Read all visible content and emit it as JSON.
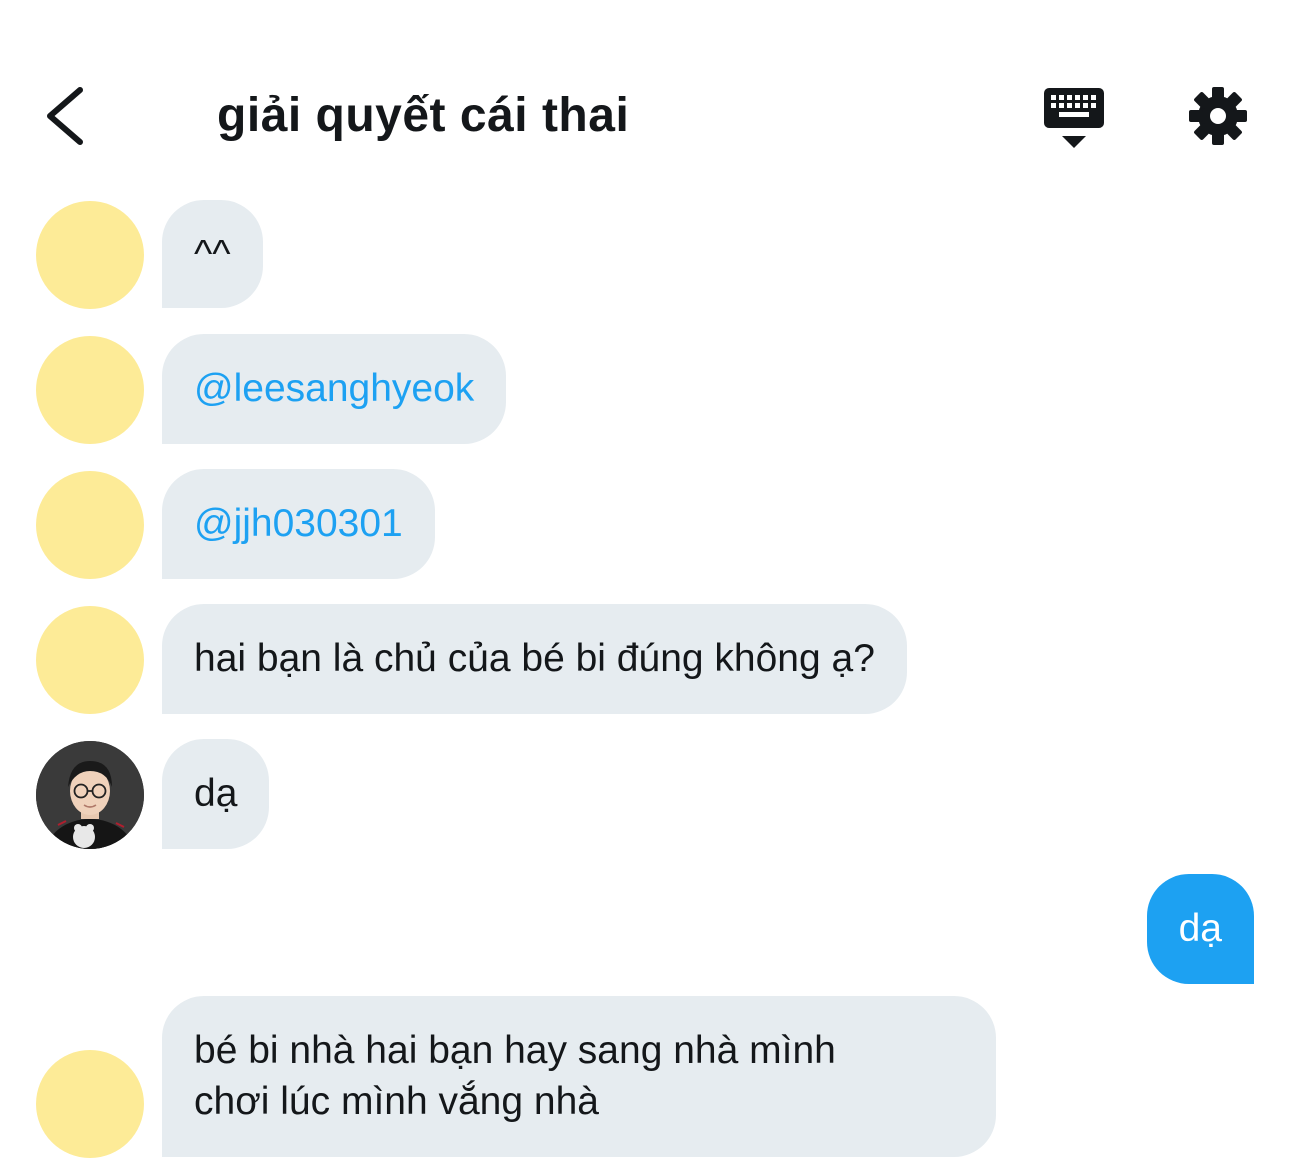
{
  "header": {
    "title": "giải quyết cái thai",
    "back_icon": "chevron-left-icon",
    "keyboard_icon": "keyboard-icon",
    "settings_icon": "gear-icon"
  },
  "messages": [
    {
      "sender": "other",
      "avatar": "yellow-placeholder",
      "text": "^^"
    },
    {
      "sender": "other",
      "avatar": "yellow-placeholder",
      "text": "@leesanghyeok",
      "is_mention": true
    },
    {
      "sender": "other",
      "avatar": "yellow-placeholder",
      "text": "@jjh030301",
      "is_mention": true
    },
    {
      "sender": "other",
      "avatar": "yellow-placeholder",
      "text": "hai bạn là chủ của bé bi đúng không ạ?"
    },
    {
      "sender": "other",
      "avatar": "profile-photo",
      "text": "dạ"
    },
    {
      "sender": "me",
      "text": "dạ"
    },
    {
      "sender": "other",
      "avatar": "yellow-placeholder",
      "lines": [
        "bé bi nhà hai bạn hay sang nhà mình",
        "chơi lúc mình vắng nhà"
      ]
    }
  ],
  "colors": {
    "bubble_other": "#e6ecf0",
    "bubble_mine": "#1da1f2",
    "mention": "#1da1f2",
    "avatar_placeholder": "#fdeb97",
    "text": "#14171a"
  }
}
